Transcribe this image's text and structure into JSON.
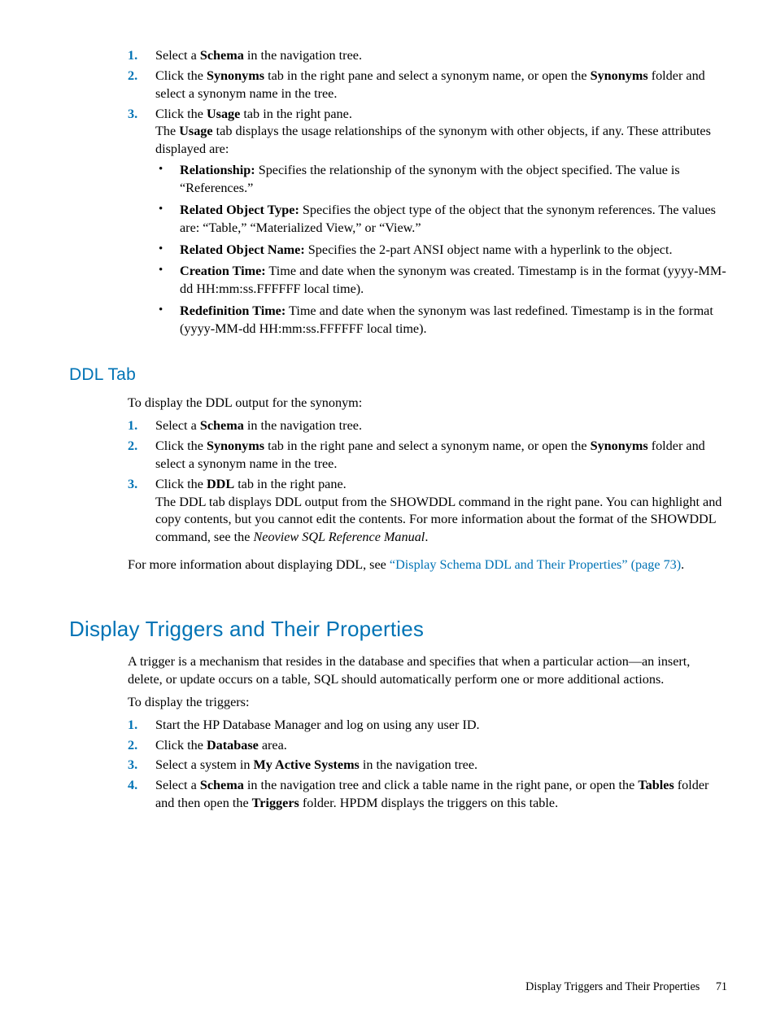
{
  "sec1": {
    "items": [
      {
        "n": "1.",
        "parts": [
          [
            "Select a "
          ],
          [
            "b",
            "Schema"
          ],
          [
            " in the navigation tree."
          ]
        ]
      },
      {
        "n": "2.",
        "parts": [
          [
            "Click the "
          ],
          [
            "b",
            "Synonyms"
          ],
          [
            " tab in the right pane and select a synonym name, or open the "
          ],
          [
            "b",
            "Synonyms"
          ],
          [
            " folder and select a synonym name in the tree."
          ]
        ]
      },
      {
        "n": "3.",
        "parts": [
          [
            "Click the "
          ],
          [
            "b",
            "Usage"
          ],
          [
            " tab in the right pane."
          ]
        ],
        "follow_parts": [
          [
            "The "
          ],
          [
            "b",
            "Usage"
          ],
          [
            " tab displays the usage relationships of the synonym with other objects, if any. These attributes displayed are:"
          ]
        ],
        "bullets": [
          {
            "parts": [
              [
                "b",
                "Relationship:"
              ],
              [
                " Specifies the relationship of the synonym with the object specified. The value is “References.”"
              ]
            ]
          },
          {
            "parts": [
              [
                "b",
                "Related Object Type:"
              ],
              [
                " Specifies the object type of the object that the synonym references. The values are: “Table,” “Materialized View,” or “View.”"
              ]
            ]
          },
          {
            "parts": [
              [
                "b",
                "Related Object Name:"
              ],
              [
                " Specifies the 2-part ANSI object name with a hyperlink to the object."
              ]
            ]
          },
          {
            "parts": [
              [
                "b",
                "Creation Time:"
              ],
              [
                " Time and date when the synonym was created. Timestamp is in the format (yyyy-MM-dd HH:mm:ss.FFFFFF local time)."
              ]
            ]
          },
          {
            "parts": [
              [
                "b",
                "Redefinition Time:"
              ],
              [
                " Time and date when the synonym was last redefined. Timestamp is in the format (yyyy-MM-dd HH:mm:ss.FFFFFF local time)."
              ]
            ]
          }
        ]
      }
    ]
  },
  "ddl": {
    "heading": "DDL Tab",
    "intro": "To display the DDL output for the synonym:",
    "items": [
      {
        "n": "1.",
        "parts": [
          [
            "Select a "
          ],
          [
            "b",
            "Schema"
          ],
          [
            " in the navigation tree."
          ]
        ]
      },
      {
        "n": "2.",
        "parts": [
          [
            "Click the "
          ],
          [
            "b",
            "Synonyms"
          ],
          [
            " tab in the right pane and select a synonym name, or open the "
          ],
          [
            "b",
            "Synonyms"
          ],
          [
            " folder and select a synonym name in the tree."
          ]
        ]
      },
      {
        "n": "3.",
        "parts": [
          [
            "Click the "
          ],
          [
            "b",
            "DDL"
          ],
          [
            " tab in the right pane."
          ]
        ],
        "follow_parts": [
          [
            "The DDL tab displays DDL output from the SHOWDDL command in the right pane. You can highlight and copy contents, but you cannot edit the contents. For more information about the format of the SHOWDDL command, see the "
          ],
          [
            "i",
            "Neoview SQL Reference Manual"
          ],
          [
            "."
          ]
        ]
      }
    ],
    "outro_before": "For more information about displaying DDL, see ",
    "outro_link": "“Display Schema DDL and Their Properties” (page 73)",
    "outro_after": "."
  },
  "triggers": {
    "heading": "Display Triggers and Their Properties",
    "para": "A trigger is a mechanism that resides in the database and specifies that when a particular action—an insert, delete, or update occurs on a table, SQL should automatically perform one or more additional actions.",
    "intro": "To display the triggers:",
    "items": [
      {
        "n": "1.",
        "parts": [
          [
            "Start the HP Database Manager and log on using any user ID."
          ]
        ]
      },
      {
        "n": "2.",
        "parts": [
          [
            "Click the "
          ],
          [
            "b",
            "Database"
          ],
          [
            " area."
          ]
        ]
      },
      {
        "n": "3.",
        "parts": [
          [
            "Select a system in "
          ],
          [
            "b",
            "My Active Systems"
          ],
          [
            " in the navigation tree."
          ]
        ]
      },
      {
        "n": "4.",
        "parts": [
          [
            "Select a "
          ],
          [
            "b",
            "Schema"
          ],
          [
            " in the navigation tree and click a table name in the right pane, or open the "
          ],
          [
            "b",
            "Tables"
          ],
          [
            " folder and then open the "
          ],
          [
            "b",
            "Triggers"
          ],
          [
            " folder. HPDM displays the triggers on this table."
          ]
        ]
      }
    ]
  },
  "footer": {
    "title": "Display Triggers and Their Properties",
    "page": "71"
  }
}
